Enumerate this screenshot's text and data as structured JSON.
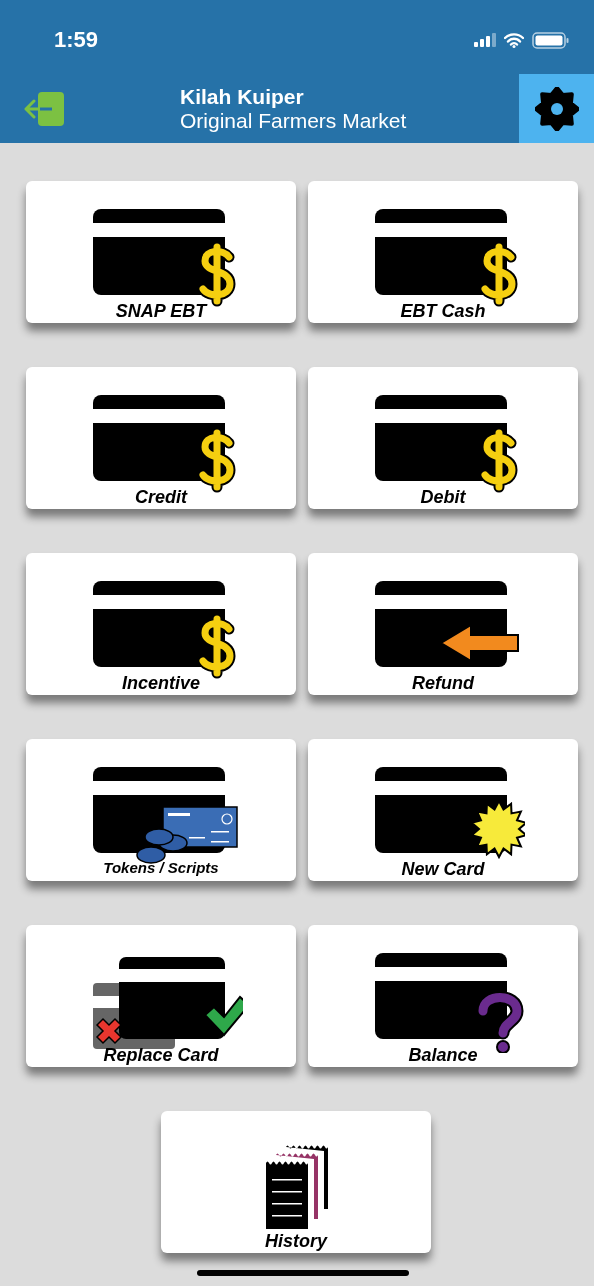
{
  "status_bar": {
    "time": "1:59"
  },
  "header": {
    "user_name": "Kilah Kuiper",
    "market_name": "Original Farmers Market"
  },
  "tiles": [
    {
      "label": "SNAP EBT",
      "kind": "dollar"
    },
    {
      "label": "EBT Cash",
      "kind": "dollar"
    },
    {
      "label": "Credit",
      "kind": "dollar"
    },
    {
      "label": "Debit",
      "kind": "dollar"
    },
    {
      "label": "Incentive",
      "kind": "dollar"
    },
    {
      "label": "Refund",
      "kind": "arrow"
    },
    {
      "label": "Tokens / Scripts",
      "kind": "tokens"
    },
    {
      "label": "New Card",
      "kind": "burst"
    },
    {
      "label": "Replace Card",
      "kind": "replace"
    },
    {
      "label": "Balance",
      "kind": "question"
    },
    {
      "label": "History",
      "kind": "history"
    }
  ]
}
